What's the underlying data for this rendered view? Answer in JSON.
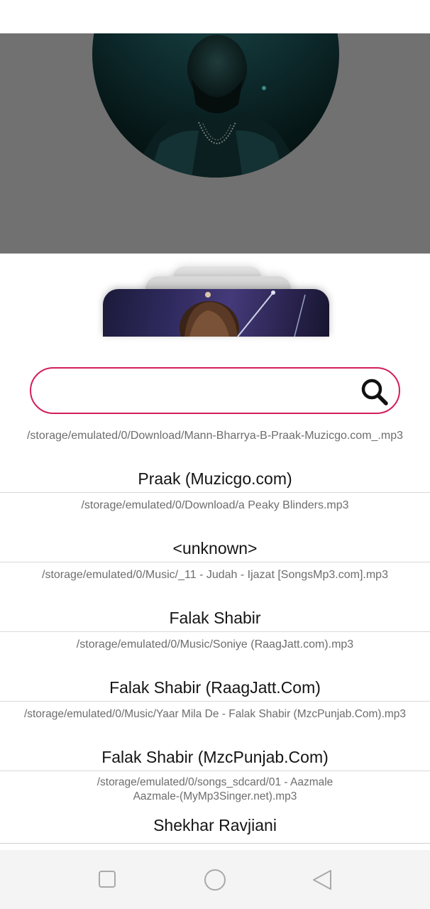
{
  "search": {
    "value": "",
    "placeholder": ""
  },
  "songs": [
    {
      "path": "/storage/emulated/0/Download/Mann-Bharrya-B-Praak-Muzicgo.com_.mp3",
      "artist": "Praak (Muzicgo.com)"
    },
    {
      "path": "/storage/emulated/0/Download/a Peaky Blinders.mp3",
      "artist": "<unknown>"
    },
    {
      "path": "/storage/emulated/0/Music/_11 - Judah - Ijazat [SongsMp3.com].mp3",
      "artist": "Falak Shabir"
    },
    {
      "path": "/storage/emulated/0/Music/Soniye (RaagJatt.com).mp3",
      "artist": "Falak Shabir (RaagJatt.Com)"
    },
    {
      "path": "/storage/emulated/0/Music/Yaar Mila De - Falak Shabir (MzcPunjab.Com).mp3",
      "artist": "Falak Shabir (MzcPunjab.Com)"
    },
    {
      "path": "/storage/emulated/0/songs_sdcard/01 - Aazmale Aazmale-(MyMp3Singer.net).mp3",
      "artist": "Shekhar Ravjiani"
    }
  ],
  "icons": {
    "search": "search-icon",
    "recents": "square-icon",
    "home": "circle-icon",
    "back": "triangle-back-icon"
  },
  "colors": {
    "accent": "#d31e5b",
    "hero_background": "#717171"
  }
}
